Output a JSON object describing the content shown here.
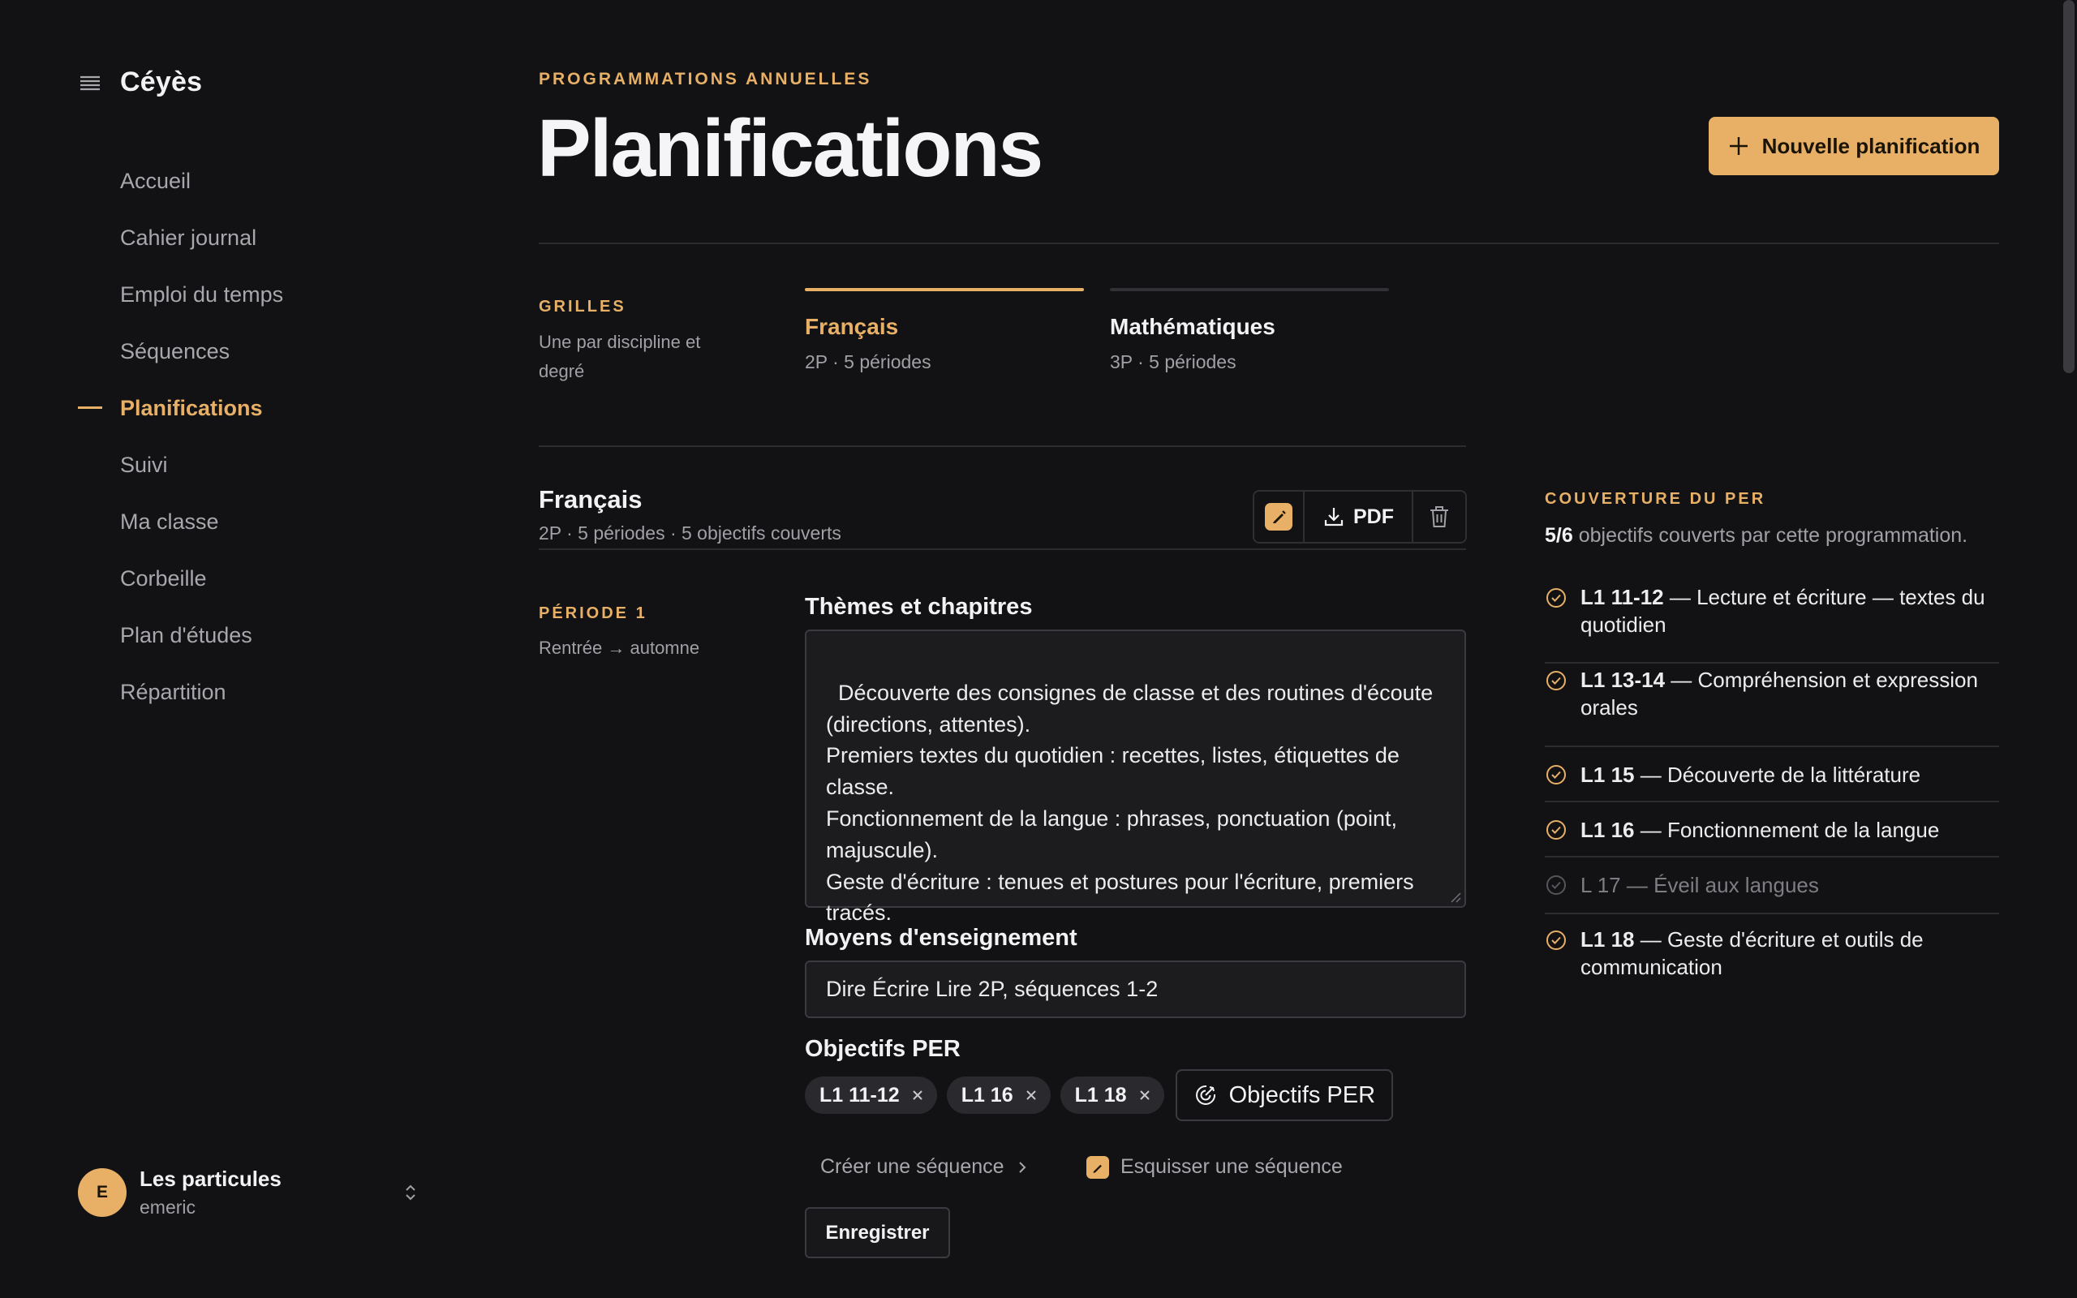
{
  "app": {
    "name": "Céyès"
  },
  "sidebar": {
    "items": [
      {
        "label": "Accueil"
      },
      {
        "label": "Cahier journal"
      },
      {
        "label": "Emploi du temps"
      },
      {
        "label": "Séquences"
      },
      {
        "label": "Planifications",
        "active": true
      },
      {
        "label": "Suivi"
      },
      {
        "label": "Ma classe"
      },
      {
        "label": "Corbeille"
      },
      {
        "label": "Plan d'études"
      },
      {
        "label": "Répartition"
      }
    ],
    "account": {
      "initial": "E",
      "name": "Les particules",
      "user": "emeric"
    }
  },
  "header": {
    "eyebrow": "PROGRAMMATIONS ANNUELLES",
    "title": "Planifications",
    "new_button": "Nouvelle planification"
  },
  "grids": {
    "label": "GRILLES",
    "description": "Une par discipline et degré",
    "tabs": [
      {
        "title": "Français",
        "sub": "2P · 5 périodes",
        "active": true
      },
      {
        "title": "Mathématiques",
        "sub": "3P · 5 périodes",
        "active": false
      }
    ]
  },
  "plan": {
    "title": "Français",
    "subtitle": "2P · 5 périodes · 5 objectifs couverts",
    "pdf_label": "PDF",
    "period": {
      "label": "PÉRIODE 1",
      "sub": "Rentrée → automne",
      "themes_label": "Thèmes et chapitres",
      "themes_text": "Découverte des consignes de classe et des routines d'écoute (directions, attentes).\nPremiers textes du quotidien : recettes, listes, étiquettes de classe.\nFonctionnement de la langue : phrases, ponctuation (point, majuscule).\nGeste d'écriture : tenues et postures pour l'écriture, premiers tracés.",
      "means_label": "Moyens d'enseignement",
      "means_value": "Dire Écrire Lire 2P, séquences 1-2",
      "objectives_label": "Objectifs PER",
      "chips": [
        {
          "label": "L1 11-12"
        },
        {
          "label": "L1 16"
        },
        {
          "label": "L1 18"
        }
      ],
      "objectives_button": "Objectifs PER",
      "create_sequence": "Créer une séquence",
      "sketch_sequence": "Esquisser une séquence",
      "save": "Enregistrer"
    }
  },
  "coverage": {
    "label": "COUVERTURE DU PER",
    "count": "5/6",
    "summary": "objectifs couverts par cette programmation.",
    "items": [
      {
        "code": "L1 11-12",
        "text": " — Lecture et écriture — textes du quotidien",
        "covered": true
      },
      {
        "code": "L1 13-14",
        "text": " — Compréhension et expression orales",
        "covered": true
      },
      {
        "code": "L1 15",
        "text": " — Découverte de la littérature",
        "covered": true
      },
      {
        "code": "L1 16",
        "text": " — Fonctionnement de la langue",
        "covered": true
      },
      {
        "code": "L 17",
        "text": " — Éveil aux langues",
        "covered": false
      },
      {
        "code": "L1 18",
        "text": " — Geste d'écriture et outils de communication",
        "covered": true
      }
    ]
  },
  "colors": {
    "accent": "#e8b066",
    "background": "#121214",
    "text": "#f2f2f4",
    "muted": "#a0a0a6"
  },
  "icons": [
    "menu-icon",
    "plus-icon",
    "edit-icon",
    "download-icon",
    "trash-icon",
    "x-icon",
    "target-icon",
    "chevron-right-icon",
    "sketch-icon",
    "check-circle-icon",
    "chevron-updown-icon"
  ]
}
